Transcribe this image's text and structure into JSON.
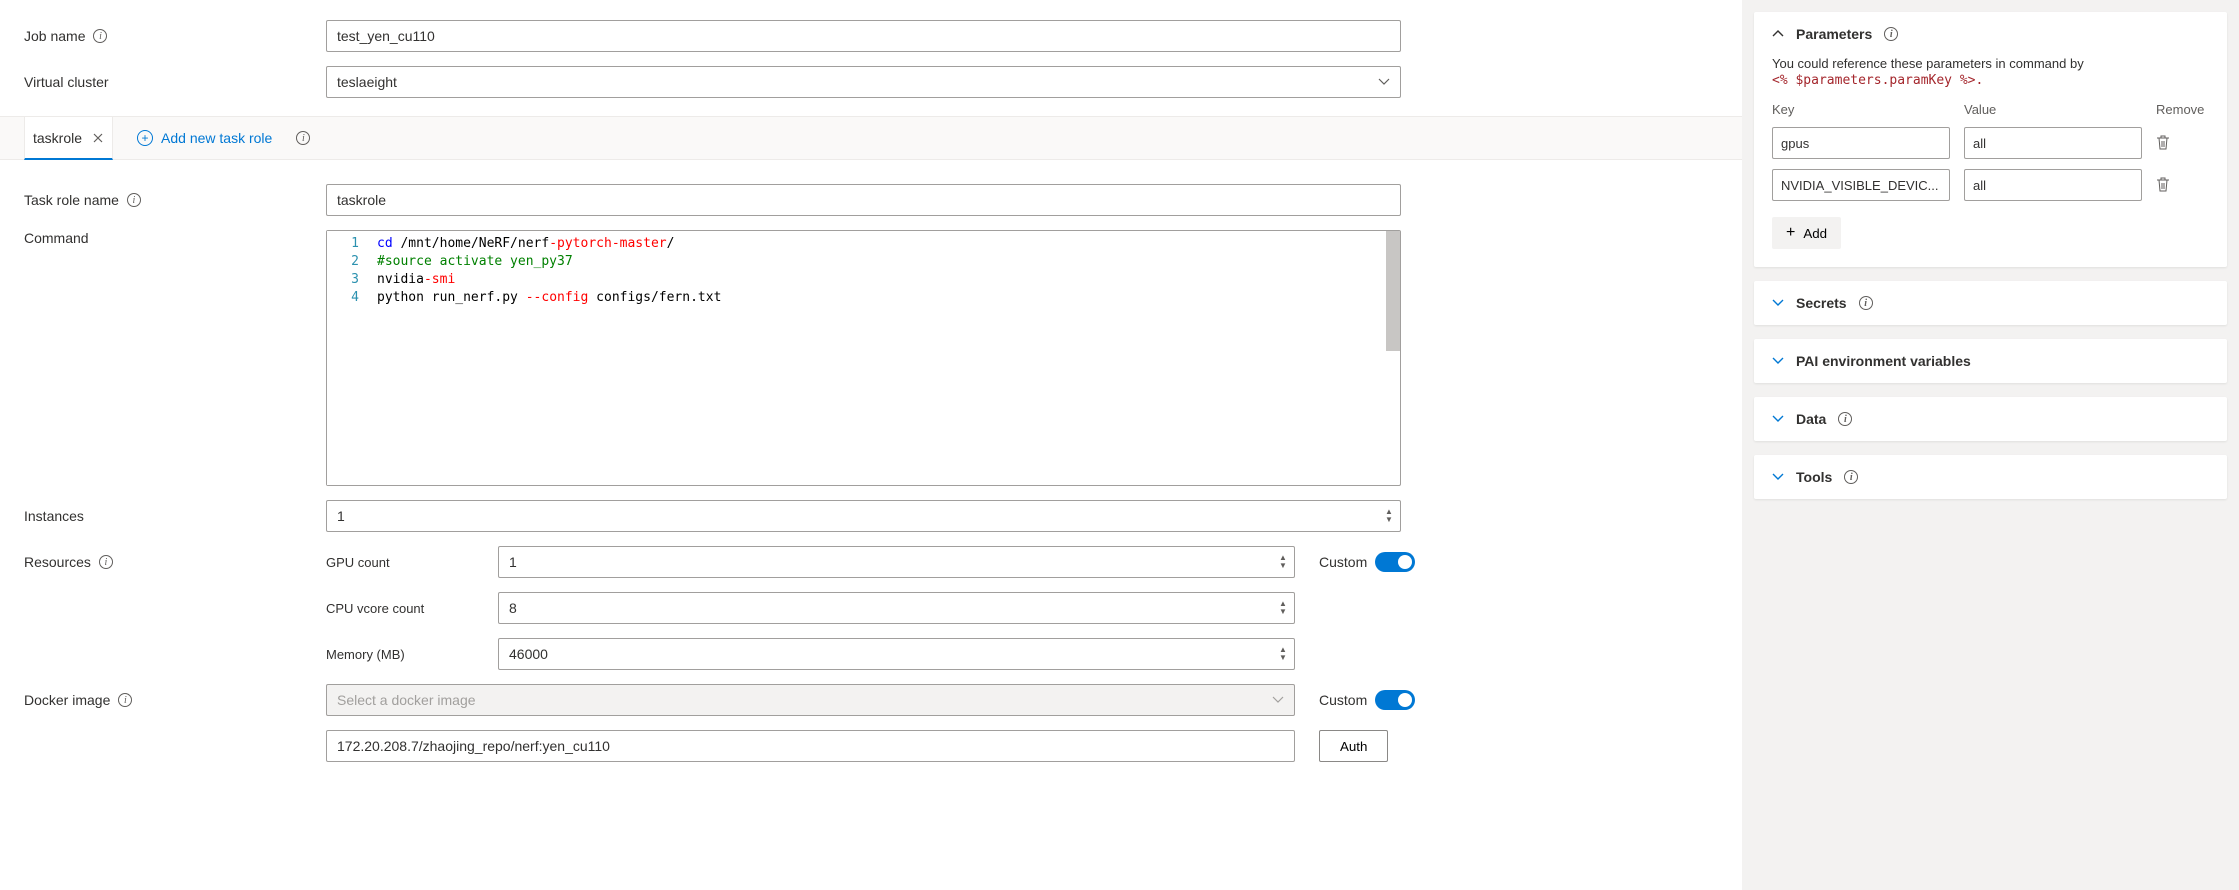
{
  "form": {
    "jobNameLabel": "Job name",
    "jobNameValue": "test_yen_cu110",
    "virtualClusterLabel": "Virtual cluster",
    "virtualClusterValue": "teslaeight",
    "taskRoleNameLabel": "Task role name",
    "taskRoleNameValue": "taskrole",
    "commandLabel": "Command",
    "instancesLabel": "Instances",
    "instancesValue": "1",
    "resourcesLabel": "Resources",
    "gpuCountLabel": "GPU count",
    "gpuCountValue": "1",
    "cpuCountLabel": "CPU vcore count",
    "cpuCountValue": "8",
    "memoryLabel": "Memory (MB)",
    "memoryValue": "46000",
    "dockerImageLabel": "Docker image",
    "dockerPlaceholder": "Select a docker image",
    "dockerValue": "172.20.208.7/zhaojing_repo/nerf:yen_cu110",
    "customLabel": "Custom",
    "authLabel": "Auth"
  },
  "tabs": {
    "taskroleTab": "taskrole",
    "addNew": "Add new task role"
  },
  "command": {
    "line1_kw": "cd",
    "line1_rest": " /mnt/home/NeRF/nerf",
    "line1_hy": "-pytorch-master",
    "line1_tail": "/",
    "line2": "#source activate yen_py37",
    "line3_a": "nvidia",
    "line3_b": "-smi",
    "line4_a": "python run_nerf.py ",
    "line4_b": "--config",
    "line4_c": " configs/fern.txt"
  },
  "side": {
    "parameters": {
      "title": "Parameters",
      "hint": "You could reference these parameters in command by",
      "hintCode": "<% $parameters.paramKey %>.",
      "keyHeader": "Key",
      "valueHeader": "Value",
      "removeHeader": "Remove",
      "rows": [
        {
          "key": "gpus",
          "value": "all"
        },
        {
          "key": "NVIDIA_VISIBLE_DEVIC...",
          "value": "all"
        }
      ],
      "addLabel": "Add"
    },
    "secrets": "Secrets",
    "paiEnv": "PAI environment variables",
    "data": "Data",
    "tools": "Tools"
  }
}
